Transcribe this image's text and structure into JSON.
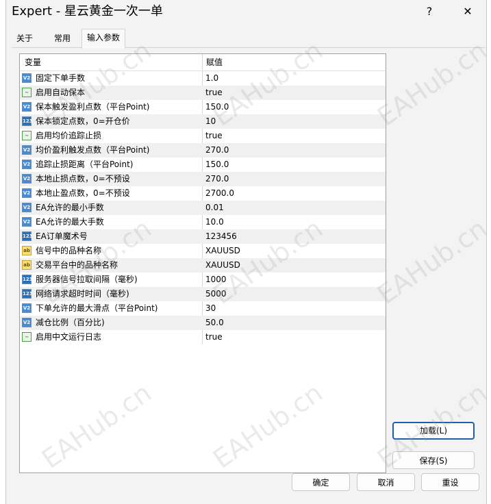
{
  "window": {
    "title": "Expert - 星云黄金一次一单",
    "help": "?",
    "close": "✕"
  },
  "tabs": [
    {
      "label": "关于"
    },
    {
      "label": "常用"
    },
    {
      "label": "输入参数"
    }
  ],
  "table": {
    "headers": {
      "variable": "变量",
      "value": "赋值"
    },
    "rows": [
      {
        "icon": "V2",
        "type": "num",
        "name": "固定下单手数",
        "value": "1.0"
      },
      {
        "icon": "~",
        "type": "bool",
        "name": "启用自动保本",
        "value": "true"
      },
      {
        "icon": "V2",
        "type": "num",
        "name": "保本触发盈利点数（平台Point)",
        "value": "150.0"
      },
      {
        "icon": "123",
        "type": "int",
        "name": "保本锁定点数，0=开仓价",
        "value": "10"
      },
      {
        "icon": "~",
        "type": "bool",
        "name": "启用均价追踪止损",
        "value": "true"
      },
      {
        "icon": "V2",
        "type": "num",
        "name": "均价盈利触发点数（平台Point)",
        "value": "270.0"
      },
      {
        "icon": "V2",
        "type": "num",
        "name": "追踪止损距离（平台Point)",
        "value": "150.0"
      },
      {
        "icon": "V2",
        "type": "num",
        "name": "本地止损点数，0=不预设",
        "value": "270.0"
      },
      {
        "icon": "V2",
        "type": "num",
        "name": "本地止盈点数，0=不预设",
        "value": "2700.0"
      },
      {
        "icon": "V2",
        "type": "num",
        "name": "EA允许的最小手数",
        "value": "0.01"
      },
      {
        "icon": "V2",
        "type": "num",
        "name": "EA允许的最大手数",
        "value": "10.0"
      },
      {
        "icon": "123",
        "type": "int",
        "name": "EA订单魔术号",
        "value": "123456"
      },
      {
        "icon": "ab",
        "type": "str",
        "name": "信号中的品种名称",
        "value": "XAUUSD"
      },
      {
        "icon": "ab",
        "type": "str",
        "name": "交易平台中的品种名称",
        "value": "XAUUSD"
      },
      {
        "icon": "123",
        "type": "int",
        "name": "服务器信号拉取间隔（毫秒)",
        "value": "1000"
      },
      {
        "icon": "123",
        "type": "int",
        "name": "网络请求超时时间（毫秒)",
        "value": "5000"
      },
      {
        "icon": "V2",
        "type": "num",
        "name": "下单允许的最大滑点（平台Point)",
        "value": "30"
      },
      {
        "icon": "V2",
        "type": "num",
        "name": "减仓比例（百分比)",
        "value": "50.0"
      },
      {
        "icon": "~",
        "type": "bool",
        "name": "启用中文运行日志",
        "value": "true"
      }
    ]
  },
  "buttons": {
    "load": "加载(L)",
    "save": "保存(S)",
    "ok": "确定",
    "cancel": "取消",
    "reset": "重设"
  },
  "watermark": "EAHub.cn",
  "colors": {
    "focus_border": "#1f5fa8",
    "alt_row": "#f0f0f0"
  }
}
